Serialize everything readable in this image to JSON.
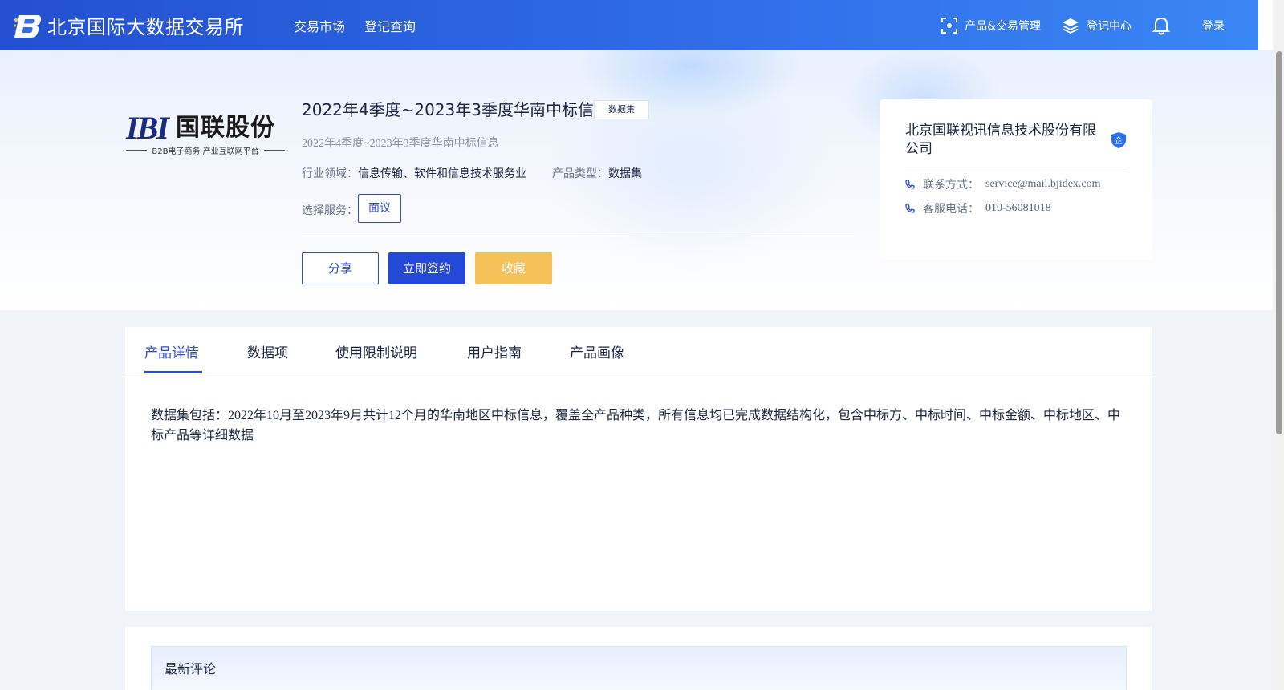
{
  "header": {
    "site_name": "北京国际大数据交易所",
    "nav": [
      "交易市场",
      "登记查询"
    ],
    "tools": {
      "product_mgmt": "产品&交易管理",
      "registry_center": "登记中心",
      "login": "登录"
    }
  },
  "product": {
    "logo_mark": "IBI",
    "logo_text": "国联股份",
    "logo_subtitle": "B2B电子商务 产业互联网平台",
    "title": "2022年4季度~2023年3季度华南中标信息",
    "tag": "数据集",
    "subtitle": "2022年4季度~2023年3季度华南中标信息",
    "industry_label": "行业领域：",
    "industry_value": "信息传输、软件和信息技术服务业",
    "type_label": "产品类型：",
    "type_value": "数据集",
    "service_label": "选择服务：",
    "service_option": "面议",
    "buttons": {
      "share": "分享",
      "sign": "立即签约",
      "favorite": "收藏"
    }
  },
  "seller": {
    "name": "北京国联视讯信息技术股份有限公司",
    "badge": "企",
    "contact_label": "联系方式：",
    "contact_value": "service@mail.bjidex.com",
    "phone_label": "客服电话：",
    "phone_value": "010-56081018"
  },
  "tabs": [
    "产品详情",
    "数据项",
    "使用限制说明",
    "用户指南",
    "产品画像"
  ],
  "active_tab": 0,
  "description": "数据集包括：2022年10月至2023年9月共计12个月的华南地区中标信息，覆盖全产品种类，所有信息均已完成数据结构化，包含中标方、中标时间、中标金额、中标地区、中标产品等详细数据",
  "comments": {
    "title": "最新评论"
  },
  "colors": {
    "primary": "#2449d8",
    "favorite": "#f5c25a",
    "header_start": "#2350d0",
    "header_end": "#3a86f5"
  },
  "icons": [
    "site-logo-icon",
    "scan-icon",
    "layers-icon",
    "bell-icon",
    "verified-shield-icon",
    "phone-icon"
  ]
}
